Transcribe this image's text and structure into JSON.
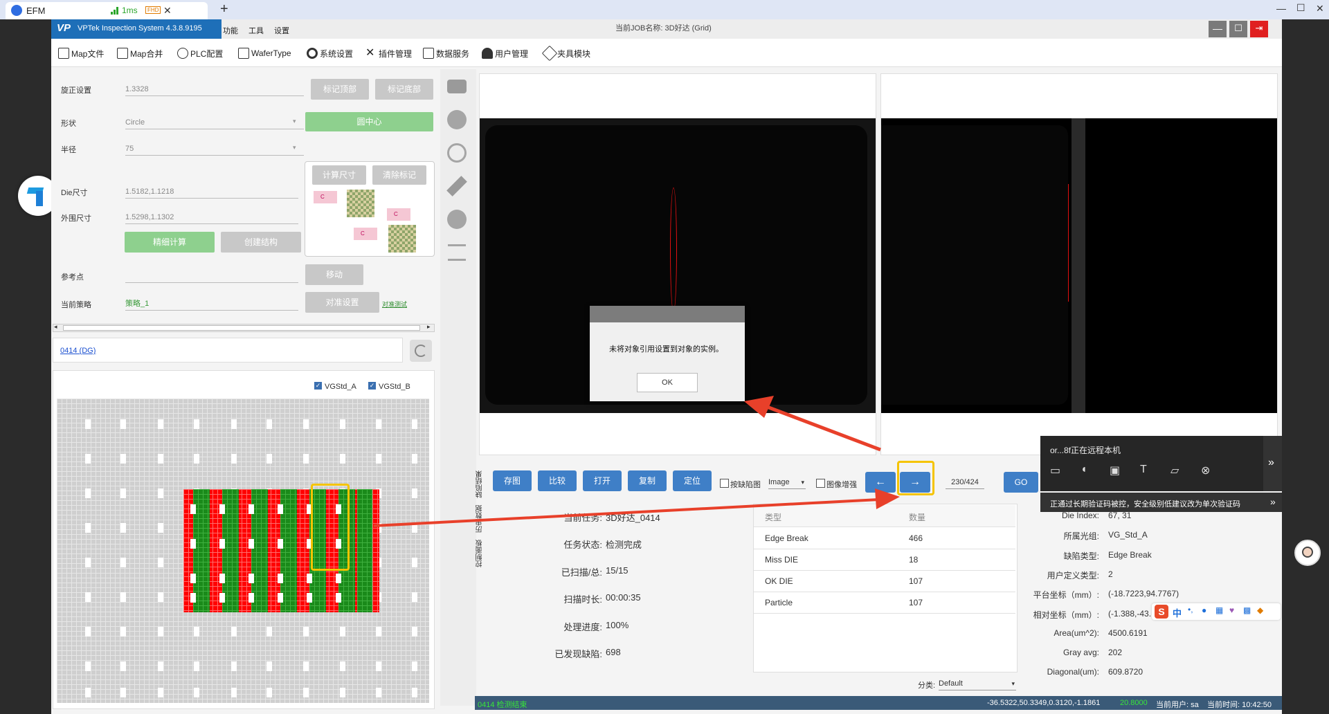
{
  "browser": {
    "tab_title": "EFM",
    "ping": "1ms",
    "badge": "FHD",
    "close": "✕",
    "new_tab": "+",
    "win_min": "—",
    "win_max": "☐",
    "win_close": "✕"
  },
  "app": {
    "title": "VPTek Inspection System 4.3.8.9195",
    "logo": "VP",
    "menu": [
      "功能",
      "工具",
      "设置"
    ],
    "job_label": "当前JOB名称: 3D好达 (Grid)"
  },
  "toolbar": [
    "Map文件",
    "Map合并",
    "PLC配置",
    "WaferType",
    "系统设置",
    "插件管理",
    "数据服务",
    "用户管理",
    "夹具模块"
  ],
  "settings": {
    "rotate_label": "旋正设置",
    "rotate_value": "1.3328",
    "mark_top": "标记顶部",
    "mark_bottom": "标记底部",
    "shape_label": "形状",
    "shape_value": "Circle",
    "circle_center": "圆中心",
    "radius_label": "半径",
    "radius_value": "75",
    "die_size_label": "Die尺寸",
    "die_size_value": "1.5182,1.1218",
    "outer_size_label": "外围尺寸",
    "outer_size_value": "1.5298,1.1302",
    "calc_size": "计算尺寸",
    "clear_mark": "清除标记",
    "fine_calc": "精细计算",
    "create_struct": "创建结构",
    "ref_point_label": "参考点",
    "move": "移动",
    "strategy_label": "当前策略",
    "strategy_value": "策略_1",
    "align_setting": "对准设置",
    "align_test": "对准测试",
    "diagram_c": "C"
  },
  "wafer": {
    "file_link": "0414 (DG)",
    "check_a": "VGStd_A",
    "check_b": "VGStd_B"
  },
  "dialog": {
    "message": "未将对象引用设置到对象的实例。",
    "ok": "OK"
  },
  "controls": {
    "save_image": "存图",
    "compare": "比较",
    "open": "打开",
    "copy": "复制",
    "locate": "定位",
    "by_defect": "按缺陷图",
    "image_select": "Image",
    "enhance": "图像增强",
    "prev_arrow": "←",
    "next_arrow": "→",
    "page": "230/424",
    "go": "GO"
  },
  "vertical_tabs": [
    "缺陷结果",
    "历史数据",
    "控制面板"
  ],
  "stats": [
    {
      "label": "当前任务:",
      "value": "3D好达_0414"
    },
    {
      "label": "任务状态:",
      "value": "检测完成"
    },
    {
      "label": "已扫描/总:",
      "value": "15/15"
    },
    {
      "label": "扫描时长:",
      "value": "00:00:35"
    },
    {
      "label": "处理进度:",
      "value": "100%"
    },
    {
      "label": "已发现缺陷:",
      "value": "698"
    }
  ],
  "defect_table": {
    "headers": [
      "类型",
      "数量"
    ],
    "rows": [
      {
        "type": "Edge Break",
        "count": "466"
      },
      {
        "type": "Miss DIE",
        "count": "18"
      },
      {
        "type": "OK DIE",
        "count": "107"
      },
      {
        "type": "Particle",
        "count": "107"
      }
    ],
    "category_label": "分类:",
    "category_value": "Default"
  },
  "details": [
    {
      "label": "Die Index:",
      "value": "67, 31"
    },
    {
      "label": "所属光组:",
      "value": "VG_Std_A"
    },
    {
      "label": "缺陷类型:",
      "value": "Edge Break"
    },
    {
      "label": "用户定义类型:",
      "value": "2"
    },
    {
      "label": "平台坐标（mm）:",
      "value": "(-18.7223,94.7767)"
    },
    {
      "label": "相对坐标（mm）:",
      "value": "(-1.388,-43."
    },
    {
      "label": "Area(um^2):",
      "value": "4500.6191"
    },
    {
      "label": "Gray avg:",
      "value": "202"
    },
    {
      "label": "Diagonal(um):",
      "value": "609.8720"
    }
  ],
  "remote": {
    "title": "or...8f正在远程本机",
    "notice": "正通过长期验证码被控，安全级别低建议改为单次验证码",
    "expand": "»"
  },
  "ime": {
    "char": "中"
  },
  "status_bar": {
    "left": "0414 检测结束",
    "coords": "-36.5322,50.3349,0.3120,-1.1861",
    "value_green": "20.8000",
    "user": "当前用户: sa",
    "time": "当前时间: 10:42:50"
  },
  "colors": {
    "brand_blue": "#1e6fb8",
    "defect_red": "#ff0000",
    "ok_green": "#1a8a1a",
    "highlight_yellow": "#f5c400",
    "arrow_red": "#e8402a"
  }
}
